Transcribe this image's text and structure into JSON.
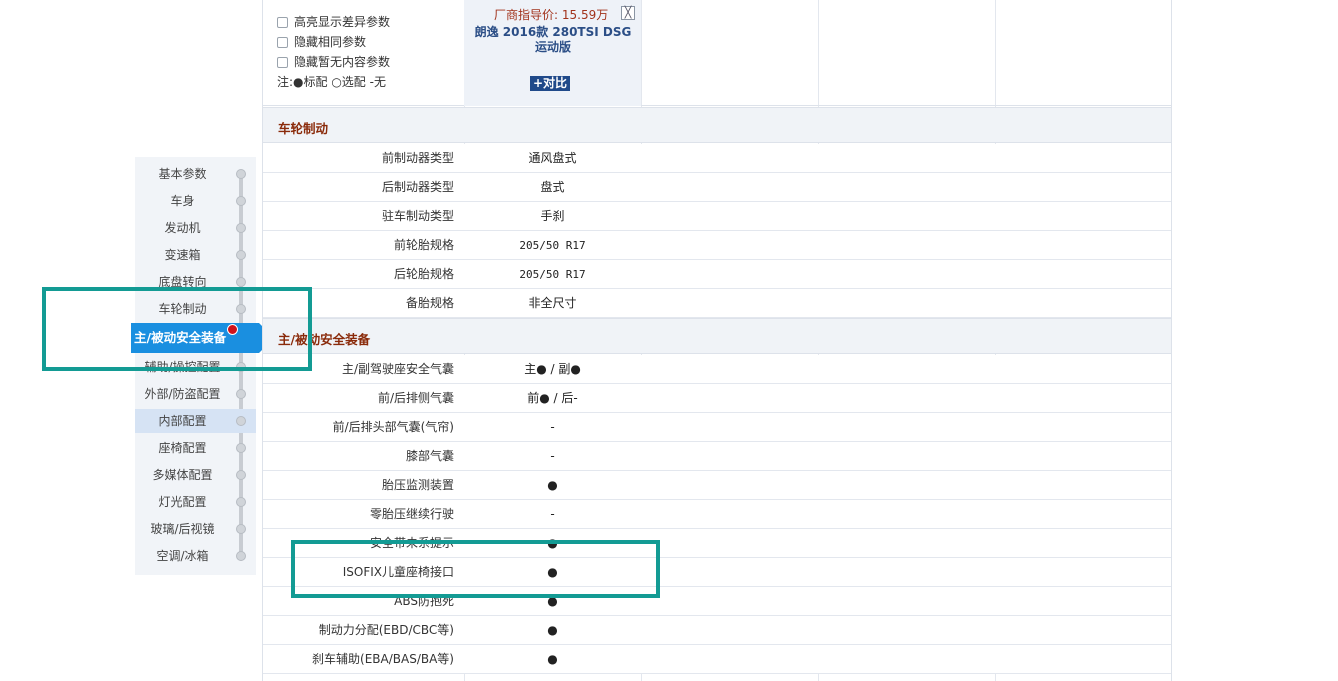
{
  "options": [
    {
      "label": "高亮显示差异参数"
    },
    {
      "label": "隐藏相同参数"
    },
    {
      "label": "隐藏暂无内容参数"
    }
  ],
  "legend_note": "注:●标配 ○选配 -无",
  "car": {
    "price": "厂商指导价: 15.59万",
    "close_symbol": "╳",
    "name_line1": "朗逸 2016款 280TSI DSG",
    "name_line2": "运动版",
    "compare_label": "+对比"
  },
  "nav": {
    "items": [
      "基本参数",
      "车身",
      "发动机",
      "变速箱",
      "底盘转向",
      "车轮制动",
      "主/被动安全装备",
      "辅助/操控配置",
      "外部/防盗配置",
      "内部配置",
      "座椅配置",
      "多媒体配置",
      "灯光配置",
      "玻璃/后视镜",
      "空调/冰箱"
    ],
    "active": "主/被动安全装备",
    "highlighted": "内部配置"
  },
  "sections": [
    {
      "title": "车轮制动",
      "rows": [
        {
          "label": "前制动器类型",
          "value": "通风盘式"
        },
        {
          "label": "后制动器类型",
          "value": "盘式"
        },
        {
          "label": "驻车制动类型",
          "value": "手刹"
        },
        {
          "label": "前轮胎规格",
          "value": "205/50 R17"
        },
        {
          "label": "后轮胎规格",
          "value": "205/50 R17"
        },
        {
          "label": "备胎规格",
          "value": "非全尺寸"
        }
      ]
    },
    {
      "title": "主/被动安全装备",
      "rows": [
        {
          "label": "主/副驾驶座安全气囊",
          "value": "主●  /  副●"
        },
        {
          "label": "前/后排侧气囊",
          "value": "前●  /  后-"
        },
        {
          "label": "前/后排头部气囊(气帘)",
          "value": "-"
        },
        {
          "label": "膝部气囊",
          "value": "-"
        },
        {
          "label": "胎压监测装置",
          "value": "●"
        },
        {
          "label": "零胎压继续行驶",
          "value": "-"
        },
        {
          "label": "安全带未系提示",
          "value": "●"
        },
        {
          "label": "ISOFIX儿童座椅接口",
          "value": "●"
        },
        {
          "label": "ABS防抱死",
          "value": "●"
        },
        {
          "label": "制动力分配(EBD/CBC等)",
          "value": "●"
        },
        {
          "label": "刹车辅助(EBA/BAS/BA等)",
          "value": "●"
        }
      ]
    }
  ]
}
